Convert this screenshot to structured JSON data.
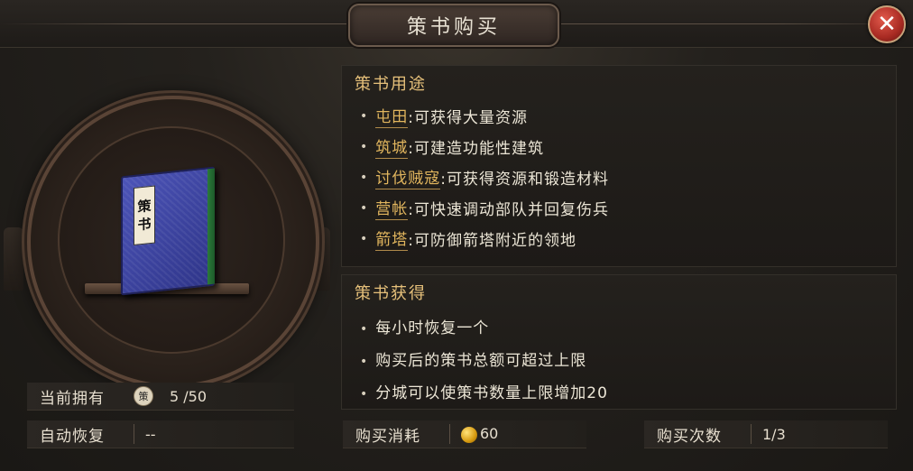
{
  "dialog": {
    "title": "策书购买"
  },
  "book": {
    "spine_label_line1": "策",
    "spine_label_line2": "书"
  },
  "uses": {
    "title": "策书用途",
    "items": [
      {
        "keyword": "屯田",
        "desc": ":可获得大量资源"
      },
      {
        "keyword": "筑城",
        "desc": ":可建造功能性建筑"
      },
      {
        "keyword": "讨伐贼寇",
        "desc": ":可获得资源和锻造材料"
      },
      {
        "keyword": "营帐",
        "desc": ":可快速调动部队并回复伤兵"
      },
      {
        "keyword": "箭塔",
        "desc": ":可防御箭塔附近的领地"
      }
    ]
  },
  "gain": {
    "title": "策书获得",
    "items": [
      "每小时恢复一个",
      "购买后的策书总额可超过上限",
      "分城可以使策书数量上限增加20"
    ]
  },
  "owned": {
    "label": "当前拥有",
    "icon_text": "策",
    "value": "5 /50"
  },
  "recover": {
    "label": "自动恢复",
    "value": "--"
  },
  "cost": {
    "label": "购买消耗",
    "value": "60"
  },
  "times": {
    "label": "购买次数",
    "value": "1/3"
  },
  "close_glyph": "✕",
  "bullet": "•"
}
